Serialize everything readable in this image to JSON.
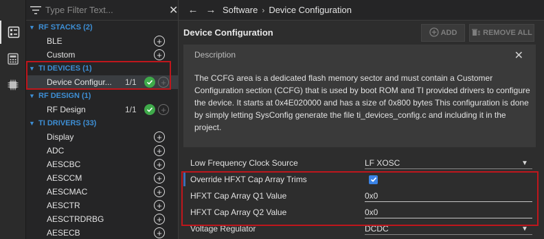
{
  "filter": {
    "placeholder": "Type Filter Text..."
  },
  "sidebar": {
    "categories": [
      {
        "label": "RF STACKS (2)",
        "items": [
          {
            "label": "BLE"
          },
          {
            "label": "Custom"
          }
        ]
      },
      {
        "label": "TI DEVICES (1)",
        "items": [
          {
            "label": "Device Configur...",
            "count": "1/1"
          }
        ]
      },
      {
        "label": "RF DESIGN (1)",
        "items": [
          {
            "label": "RF Design",
            "count": "1/1"
          }
        ]
      },
      {
        "label": "TI DRIVERS (33)",
        "items": [
          {
            "label": "Display"
          },
          {
            "label": "ADC"
          },
          {
            "label": "AESCBC"
          },
          {
            "label": "AESCCM"
          },
          {
            "label": "AESCMAC"
          },
          {
            "label": "AESCTR"
          },
          {
            "label": "AESCTRDRBG"
          },
          {
            "label": "AESECB"
          }
        ]
      }
    ]
  },
  "breadcrumb": {
    "root": "Software",
    "current": "Device Configuration"
  },
  "main": {
    "title": "Device Configuration",
    "add_label": "ADD",
    "remove_all_label": "REMOVE ALL"
  },
  "description": {
    "heading": "Description",
    "body": "The CCFG area is a dedicated flash memory sector and must contain a Customer Configuration section (CCFG) that is used by boot ROM and TI provided drivers to configure the device. It starts at 0x4E020000 and has a size of 0x800 bytes This configuration is done by simply letting SysConfig generate the file ti_devices_config.c and including it in the project."
  },
  "settings": {
    "lf_clock": {
      "name": "Low Frequency Clock Source",
      "value": "LF XOSC"
    },
    "override_trims": {
      "name": "Override HFXT Cap Array Trims",
      "checked": true
    },
    "q1": {
      "name": "HFXT Cap Array Q1 Value",
      "value": "0x0"
    },
    "q2": {
      "name": "HFXT Cap Array Q2 Value",
      "value": "0x0"
    },
    "regulator": {
      "name": "Voltage Regulator",
      "value": "DCDC"
    }
  },
  "colors": {
    "highlight": "#c0161c",
    "category": "#3d8fd6",
    "check": "#3faa4a",
    "checkbox": "#3a83e6"
  }
}
